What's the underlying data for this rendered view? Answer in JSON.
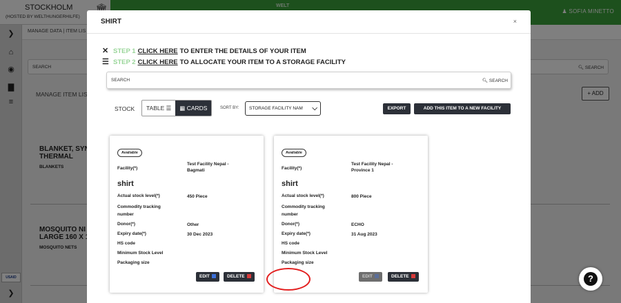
{
  "app": {
    "city": "STOCKHOLM",
    "hosted_by": "(HOSTED BY WELTHUNGERHILFE)",
    "logo_text": "WELT",
    "user_name": "SOFIA MINETTO"
  },
  "subnav": {
    "breadcrumb": "MANAGE DATA  |  ITEM LIS"
  },
  "background": {
    "search_placeholder": "SEARCH",
    "search_button": "SEARCH",
    "page_title": "MANAGE ITEM LIS",
    "add_button": "ADD",
    "items": [
      {
        "name_line1": "BLANKET, SYN",
        "name_line2": "THERMAL",
        "category": "BLANKETS"
      },
      {
        "name_line1": "MOSQUITO NI",
        "name_line2": "LARGE 160 X 1",
        "category": "MOSQUITO NETS"
      }
    ],
    "sidebar_logo": "USAID"
  },
  "modal": {
    "title": "SHIRT",
    "close": "×",
    "step1": {
      "label": "STEP 1",
      "link": "CLICK HERE",
      "text": "TO ENTER THE DETAILS OF YOUR ITEM"
    },
    "step2": {
      "label": "STEP 2",
      "link": "CLICK HERE",
      "text": "TO ALLOCATE YOUR ITEM TO A STORAGE FACILITY"
    },
    "search_placeholder": "SEARCH",
    "search_button": "SEARCH",
    "stock_label": "STOCK",
    "view_table": "TABLE",
    "view_cards": "CARDS",
    "sort_label": "SORT BY:",
    "sort_value": "STORAGE FACILITY NAM",
    "export_button": "EXPORT",
    "add_facility_button": "ADD THIS ITEM TO A NEW FACILITY"
  },
  "cards": [
    {
      "badge": "Available",
      "facility_label": "Facility(*)",
      "facility_line1": "Test Facility Nepal -",
      "facility_line2": "Bagmati",
      "item_name": "shirt",
      "stock_label": "Actual stock level(*)",
      "stock_value": "450 Piece",
      "tracking_label_1": "Commodity tracking",
      "tracking_label_2": "number",
      "donor_label": "Donor(*)",
      "donor_value": "Other",
      "expiry_label": "Expiry date(*)",
      "expiry_value": "30 Dec 2023",
      "hs_label": "HS code",
      "min_label": "Minimum Stock Level",
      "packaging_label": "Packaging size",
      "edit": "EDIT",
      "delete": "DELETE"
    },
    {
      "badge": "Available",
      "facility_label": "Facility(*)",
      "facility_line1": "Test Facility Nepal -",
      "facility_line2": "Province 1",
      "item_name": "shirt",
      "stock_label": "Actual stock level(*)",
      "stock_value": "800 Piece",
      "tracking_label_1": "Commodity tracking",
      "tracking_label_2": "number",
      "donor_label": "Donor(*)",
      "donor_value": "ECHO",
      "expiry_label": "Expiry date(*)",
      "expiry_value": "31 Aug 2023",
      "hs_label": "HS code",
      "min_label": "Minimum Stock Level",
      "packaging_label": "Packaging size",
      "edit": "EDIT",
      "delete": "DELETE"
    }
  ],
  "help": "?",
  "colors": {
    "brand_green": "#3aa03a",
    "step_green": "#9ad69a",
    "dark_button": "#2c3038",
    "highlight_ring": "#e32020"
  }
}
